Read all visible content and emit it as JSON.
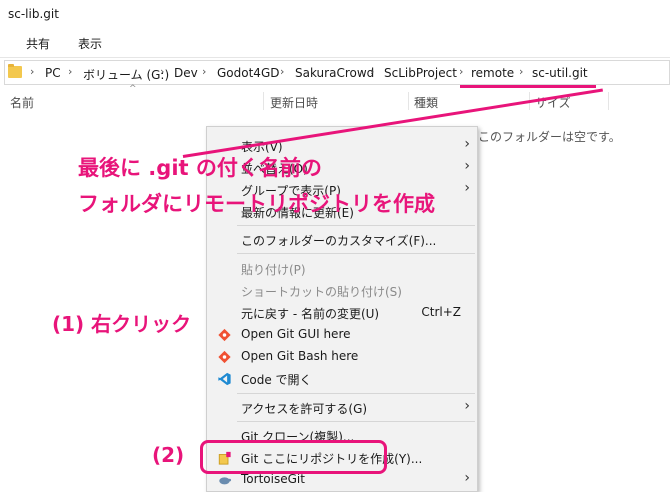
{
  "window": {
    "title": "sc-lib.git"
  },
  "ribbon": {
    "tabs": [
      "共有",
      "表示"
    ]
  },
  "address": {
    "crumbs": [
      "PC",
      "ボリューム (G:)",
      "Dev",
      "Godot4GD",
      "SakuraCrowd",
      "ScLibProject",
      "remote",
      "sc-util.git"
    ]
  },
  "columns": [
    "名前",
    "更新日時",
    "種類",
    "サイズ"
  ],
  "empty_text": "このフォルダーは空です。",
  "menu": {
    "view": "表示(V)",
    "sort": "並べ替え(O)",
    "group": "グループで表示(P)",
    "refresh": "最新の情報に更新(E)",
    "customize": "このフォルダーのカスタマイズ(F)...",
    "paste": "貼り付け(P)",
    "paste_shortcut": "ショートカットの貼り付け(S)",
    "undo": "元に戻す - 名前の変更(U)",
    "undo_shortcut": "Ctrl+Z",
    "git_gui": "Open Git GUI here",
    "git_bash": "Open Git Bash here",
    "code": "Code で開く",
    "access": "アクセスを許可する(G)",
    "git_clone": "Git クローン(複製)...",
    "git_create": "Git ここにリポジトリを作成(Y)...",
    "tortoise": "TortoiseGit"
  },
  "annotations": {
    "line1": "最後に .git の付く名前の",
    "line2": "フォルダにリモートリポジトリを作成",
    "step1": "(1) 右クリック",
    "step2": "(2)"
  },
  "colors": {
    "accent": "#e8147a",
    "menu_bg": "#f2f2f2"
  }
}
